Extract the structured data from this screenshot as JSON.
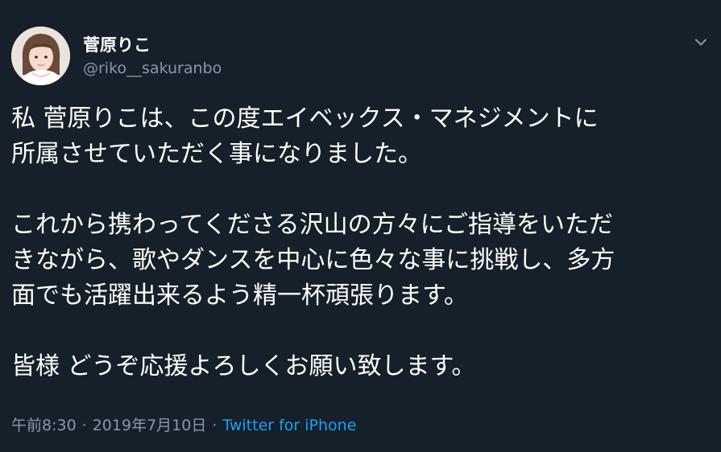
{
  "user": {
    "display_name": "菅原りこ",
    "handle": "@riko__sakuranbo"
  },
  "menu": {
    "icon": "chevron-down-icon"
  },
  "tweet": {
    "paragraphs": [
      [
        "私 菅原りこは、この度エイベックス・マネジメントに",
        "所属させていただく事になりました。"
      ],
      [
        "これから携わってくださる沢山の方々にご指導をいただ",
        "きながら、歌やダンスを中心に色々な事に挑戦し、多方",
        "面でも活躍出来るよう精一杯頑張ります。"
      ],
      [
        "皆様 どうぞ応援よろしくお願い致します。"
      ]
    ]
  },
  "meta": {
    "time": "午前8:30",
    "separator": "·",
    "date": "2019年7月10日",
    "source": "Twitter for iPhone"
  },
  "colors": {
    "background": "#15202b",
    "text": "#ffffff",
    "secondary": "#8899a6",
    "link": "#1da1f2"
  }
}
